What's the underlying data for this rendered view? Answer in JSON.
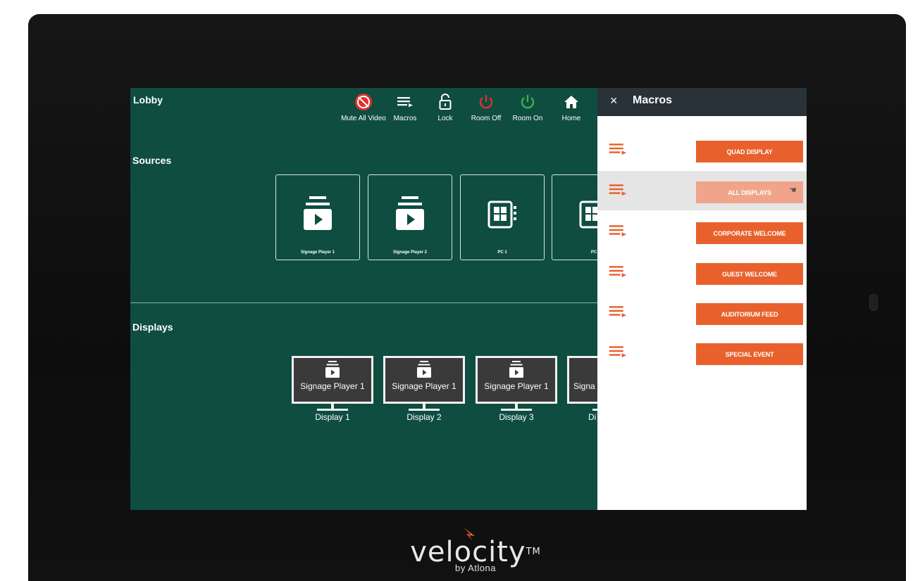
{
  "room": {
    "title": "Lobby"
  },
  "toolbar": [
    {
      "label": "Mute All Video",
      "icon": "mute-video-icon",
      "color": "#e0312f"
    },
    {
      "label": "Macros",
      "icon": "macros-icon",
      "color": "#ffffff"
    },
    {
      "label": "Lock",
      "icon": "lock-icon",
      "color": "#ffffff"
    },
    {
      "label": "Room Off",
      "icon": "power-icon",
      "color": "#e0312f"
    },
    {
      "label": "Room On",
      "icon": "power-icon",
      "color": "#3bb34a"
    },
    {
      "label": "Home",
      "icon": "home-icon",
      "color": "#ffffff"
    }
  ],
  "sources": {
    "title": "Sources",
    "items": [
      {
        "label": "Signage Player 1",
        "icon": "signage-player-icon"
      },
      {
        "label": "Signage Player 2",
        "icon": "signage-player-icon"
      },
      {
        "label": "PC 1",
        "icon": "pc-icon"
      },
      {
        "label": "PC",
        "icon": "pc-icon"
      }
    ]
  },
  "displays": {
    "title": "Displays",
    "items": [
      {
        "source": "Signage Player 1",
        "name": "Display 1"
      },
      {
        "source": "Signage Player 1",
        "name": "Display 2"
      },
      {
        "source": "Signage Player 1",
        "name": "Display 3"
      },
      {
        "source": "Signa",
        "name": "Di"
      }
    ]
  },
  "macros_panel": {
    "title": "Macros",
    "close_icon": "close-icon",
    "items": [
      {
        "label": "QUAD DISPLAY",
        "highlighted": false
      },
      {
        "label": "ALL DISPLAYS",
        "highlighted": true
      },
      {
        "label": "CORPORATE WELCOME",
        "highlighted": false
      },
      {
        "label": "GUEST WELCOME",
        "highlighted": false
      },
      {
        "label": "AUDITORIUM FEED",
        "highlighted": false
      },
      {
        "label": "SPECIAL EVENT",
        "highlighted": false
      }
    ]
  },
  "brand": {
    "name": "velocity",
    "tm": "TM",
    "sub": "by Atlona"
  },
  "colors": {
    "screen_bg": "#0e4d40",
    "accent": "#e8612c",
    "panel_header": "#283238"
  }
}
